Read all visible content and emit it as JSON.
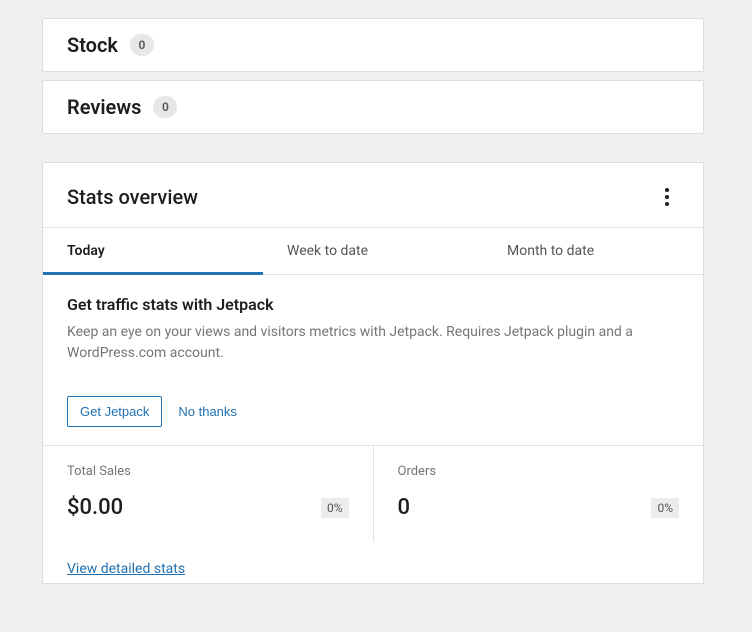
{
  "sections": {
    "stock": {
      "title": "Stock",
      "count": "0"
    },
    "reviews": {
      "title": "Reviews",
      "count": "0"
    }
  },
  "stats": {
    "title": "Stats overview",
    "tabs": [
      "Today",
      "Week to date",
      "Month to date"
    ],
    "activeTab": 0,
    "promo": {
      "title": "Get traffic stats with Jetpack",
      "description": "Keep an eye on your views and visitors metrics with Jetpack. Requires Jetpack plugin and a WordPress.com account.",
      "primary": "Get Jetpack",
      "dismiss": "No thanks"
    },
    "metrics": {
      "sales": {
        "label": "Total Sales",
        "value": "$0.00",
        "delta": "0%"
      },
      "orders": {
        "label": "Orders",
        "value": "0",
        "delta": "0%"
      }
    },
    "detailsLink": "View detailed stats"
  }
}
